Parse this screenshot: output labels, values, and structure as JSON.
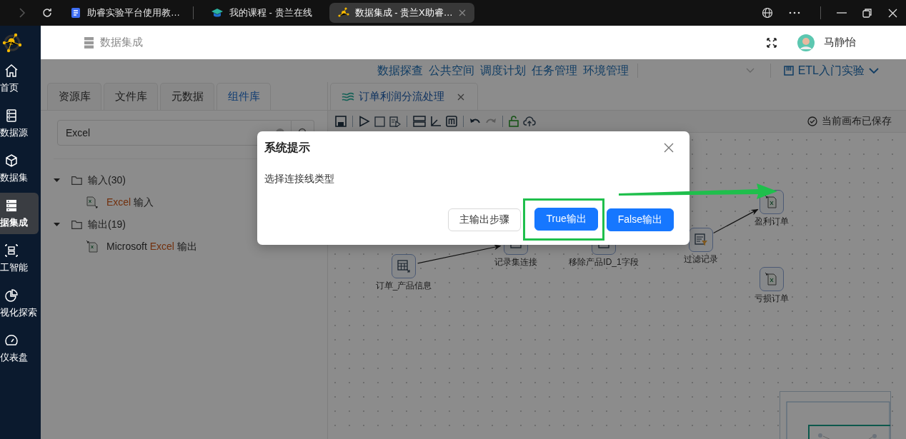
{
  "browser": {
    "tabs": [
      {
        "title": "助睿实验平台使用教…",
        "kind": "doc",
        "selected": false
      },
      {
        "title": "我的课程 - 贵兰在线",
        "kind": "cap",
        "selected": false
      },
      {
        "title": "数据集成 - 贵兰X助睿…",
        "kind": "logo",
        "selected": true
      }
    ]
  },
  "sidebar": {
    "items": [
      {
        "label": "首页",
        "kind": "home",
        "selected": false
      },
      {
        "label": "数据源",
        "kind": "list",
        "selected": false
      },
      {
        "label": "数据集",
        "kind": "cube",
        "selected": false
      },
      {
        "label": "据集成",
        "kind": "server",
        "selected": true
      },
      {
        "label": "工智能",
        "kind": "scan",
        "selected": false
      },
      {
        "label": "视化探索",
        "kind": "pie",
        "selected": false
      },
      {
        "label": "仪表盘",
        "kind": "gauge",
        "selected": false
      }
    ]
  },
  "header": {
    "title": "数据集成",
    "user": "马静怡"
  },
  "top_nav": {
    "links": [
      "数据探查",
      "公共空间",
      "调度计划",
      "任务管理",
      "环境管理"
    ],
    "project": "ETL入门实验"
  },
  "left_panel": {
    "tabs": [
      {
        "label": "资源库",
        "selected": false
      },
      {
        "label": "文件库",
        "selected": false
      },
      {
        "label": "元数据",
        "selected": false
      },
      {
        "label": "组件库",
        "selected": true
      }
    ],
    "search": {
      "value": "Excel"
    },
    "tree": [
      {
        "label": "输入(30)",
        "expanded": true,
        "children": [
          {
            "parts": [
              {
                "text": "Excel",
                "match": true
              },
              {
                "text": " 输入",
                "match": false
              }
            ],
            "kind": "input"
          }
        ]
      },
      {
        "label": "输出(19)",
        "expanded": true,
        "children": [
          {
            "parts": [
              {
                "text": "Microsoft ",
                "match": false
              },
              {
                "text": "Excel",
                "match": true
              },
              {
                "text": " 输出",
                "match": false
              }
            ],
            "kind": "output"
          }
        ]
      }
    ]
  },
  "editor": {
    "tab": "订单利润分流处理",
    "status": "当前画布已保存"
  },
  "canvas": {
    "nodes": [
      {
        "label": "订单_产品信息",
        "kind": "table"
      },
      {
        "label": "记录集连接",
        "kind": "join"
      },
      {
        "label": "移除产品ID_1字段",
        "kind": "fields"
      },
      {
        "label": "过滤记录",
        "kind": "filter"
      },
      {
        "label": "盈利订单",
        "kind": "excel-out"
      },
      {
        "label": "亏损订单",
        "kind": "excel-out"
      }
    ]
  },
  "dialog": {
    "title": "系统提示",
    "message": "选择连接线类型",
    "buttons": [
      {
        "label": "主输出步骤",
        "kind": "default",
        "highlighted": false
      },
      {
        "label": "True输出",
        "kind": "primary",
        "highlighted": true
      },
      {
        "label": "False输出",
        "kind": "primary",
        "highlighted": false
      }
    ]
  }
}
